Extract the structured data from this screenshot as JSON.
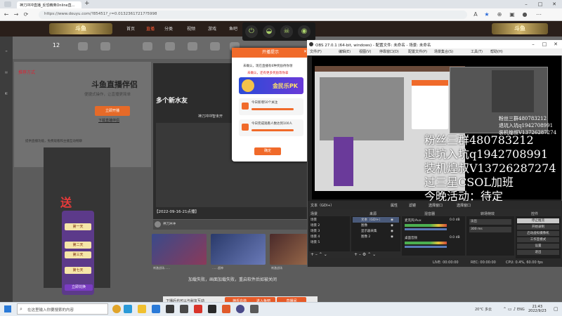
{
  "browser": {
    "tab_title": "神刀冲冲直播_反恐精英Online直...",
    "url": "https://www.douyu.com/?85451?_r=0.01323617217?5998"
  },
  "site": {
    "nav": [
      "首页",
      "直播",
      "分类",
      "视频",
      "游戏",
      "鱼吧"
    ],
    "strip_items": [
      "12",
      "",
      "",
      "",
      "",
      "",
      "",
      ""
    ],
    "promo_title": "推荐方式",
    "helper_title": "斗鱼直播伴侣",
    "helper_sub": "便捷式操作，让直播更简单",
    "open_button": "立即开播",
    "download_link": "下载直播伴侣",
    "desc_text": "提供直播功能，免费观看和主播互动畅聊",
    "friends_title": "多个新水友",
    "god_text": "神刀冲冲智未开",
    "timestamp": "【2022-09-16-21点播】",
    "uploader": "神刀冲冲",
    "thumb_captions": [
      "刺激战场……",
      "……超神",
      "刺激战场"
    ],
    "load_error": "加载失败，画面加载失败，重启软件后如被关闭",
    "gift_send": "送",
    "gift_days": [
      "第一天",
      "第二天",
      "第三天",
      "第七天"
    ],
    "redeem": "立即兑换",
    "bottom_text": "下播后也可以与秘友互动",
    "bottom_btn1": "神币充值",
    "bottom_btn2": "进入鱼吧",
    "bottom_btn3": "直播间"
  },
  "dialog": {
    "header": "开播提示",
    "line1": "未确认，现在直播有6种奖励待你领",
    "line2": "未确认，还有更多奖励等你拿",
    "pk_text": "金民乐PK",
    "task1": "今日新增50个关注",
    "task2": "今日完成观看人数达到100人",
    "ok": "确定"
  },
  "obs": {
    "title": "OBS 27.0.1 (64-bit, windows) - 配置文件: 未命名 - 场景: 未命名",
    "menu": [
      "文件(F)",
      "编辑(E)",
      "视图(V)",
      "停靠窗口(D)",
      "配置文件(P)",
      "场景集合(S)",
      "工具(T)",
      "帮助(H)"
    ],
    "overlay_lines": [
      "粉丝三群480783212",
      "退坑入坑q1942708991",
      "装机煌叔V13726287274",
      "过三星CSOL加班",
      "今晚活动：待定"
    ],
    "overlay_small": [
      "粉丝三群480783212",
      "退坑入坑q1942708991",
      "装机煌叔V13726287274"
    ],
    "toolbar": [
      "文本（GDI+）",
      "属性",
      "滤镜",
      "选择窗口",
      "选择窗口"
    ],
    "dock_heads": [
      "场景",
      "来源",
      "混音器",
      "转场特效",
      "控件"
    ],
    "scenes": [
      "场景",
      "场景 2",
      "场景 3",
      "场景 4",
      "场景 5"
    ],
    "sources": [
      "文本（GDI+）",
      "图像",
      "显示器采集",
      "图像 2"
    ],
    "mixer": [
      "麦克风/Aux",
      "桌面音频"
    ],
    "mixer_values": [
      "0.0 dB",
      "0.0 dB"
    ],
    "transition_fade": "淡出",
    "transition_duration": "300 ms",
    "controls": [
      "停止推流",
      "开始录制",
      "启动虚拟摄像机",
      "工作室模式",
      "设置",
      "退出"
    ],
    "status": [
      "LIVE: 00:00:00",
      "REC: 00:00:00",
      "CPU: 0.4%, 60.00 fps"
    ]
  },
  "taskbar": {
    "search_placeholder": "在这里输入你要搜索的内容",
    "weather": "20°C 多云",
    "lang": "ENG",
    "time": "21:43",
    "date": "2022/9/23"
  }
}
